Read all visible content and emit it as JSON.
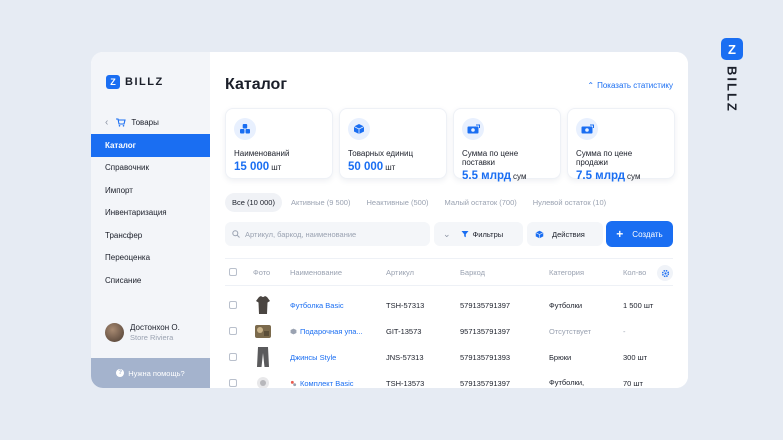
{
  "brand": {
    "logo_letter": "Z",
    "word": "BILLZ"
  },
  "sidebar": {
    "logo_letter": "Z",
    "logo_text": "BILLZ",
    "back_label": "Товары",
    "items": [
      {
        "label": "Каталог",
        "active": true
      },
      {
        "label": "Справочник"
      },
      {
        "label": "Импорт"
      },
      {
        "label": "Инвентаризация"
      },
      {
        "label": "Трансфер"
      },
      {
        "label": "Переоценка"
      },
      {
        "label": "Списание"
      }
    ],
    "user": {
      "name": "Достонхон О.",
      "store": "Store Riviera"
    },
    "help_label": "Нужна помощь?"
  },
  "main": {
    "title": "Каталог",
    "show_stats": "Показать статистику",
    "stats": [
      {
        "icon": "boxes-icon",
        "label": "Наименований",
        "value": "15 000",
        "unit": "шт"
      },
      {
        "icon": "box-icon",
        "label": "Товарных единиц",
        "value": "50 000",
        "unit": "шт"
      },
      {
        "icon": "money-icon",
        "label": "Сумма по цене поставки",
        "value": "5.5 млрд",
        "unit": "сум"
      },
      {
        "icon": "money-icon",
        "label": "Сумма по цене продажи",
        "value": "7.5 млрд",
        "unit": "сум"
      }
    ],
    "filter_tabs": [
      {
        "label": "Все (10 000)",
        "active": true
      },
      {
        "label": "Активные (9 500)"
      },
      {
        "label": "Неактивные (500)"
      },
      {
        "label": "Малый остаток (700)"
      },
      {
        "label": "Нулевой остаток (10)"
      }
    ],
    "search": {
      "placeholder": "Артикул, баркод, наименование",
      "value": ""
    },
    "filters_label": "Фильтры",
    "actions_label": "Действия",
    "create_label": "Создать",
    "table": {
      "headers": {
        "photo": "Фото",
        "name": "Наименование",
        "article": "Артикул",
        "barcode": "Баркод",
        "category": "Категория",
        "qty": "Кол-во"
      },
      "rows": [
        {
          "name": "Футболка Basic",
          "article": "TSH-57313",
          "barcode": "579135791397",
          "category": "Футболки",
          "qty": "1 500 шт"
        },
        {
          "name": "Подарочная упа...",
          "article": "GIT-13573",
          "barcode": "957135791397",
          "category": "Отсутствует",
          "qty": "-"
        },
        {
          "name": "Джинсы Style",
          "article": "JNS-57313",
          "barcode": "579135791393",
          "category": "Брюки",
          "qty": "300 шт"
        },
        {
          "name": "Комплект Basic",
          "article": "TSH-13573",
          "barcode": "579135791397",
          "category": "Футболки,",
          "qty": "70 шт"
        }
      ]
    }
  },
  "colors": {
    "accent": "#1a6ef2",
    "background": "#e6ebf3",
    "sidebar": "#f3f5f9",
    "help": "#a4b3cd"
  }
}
